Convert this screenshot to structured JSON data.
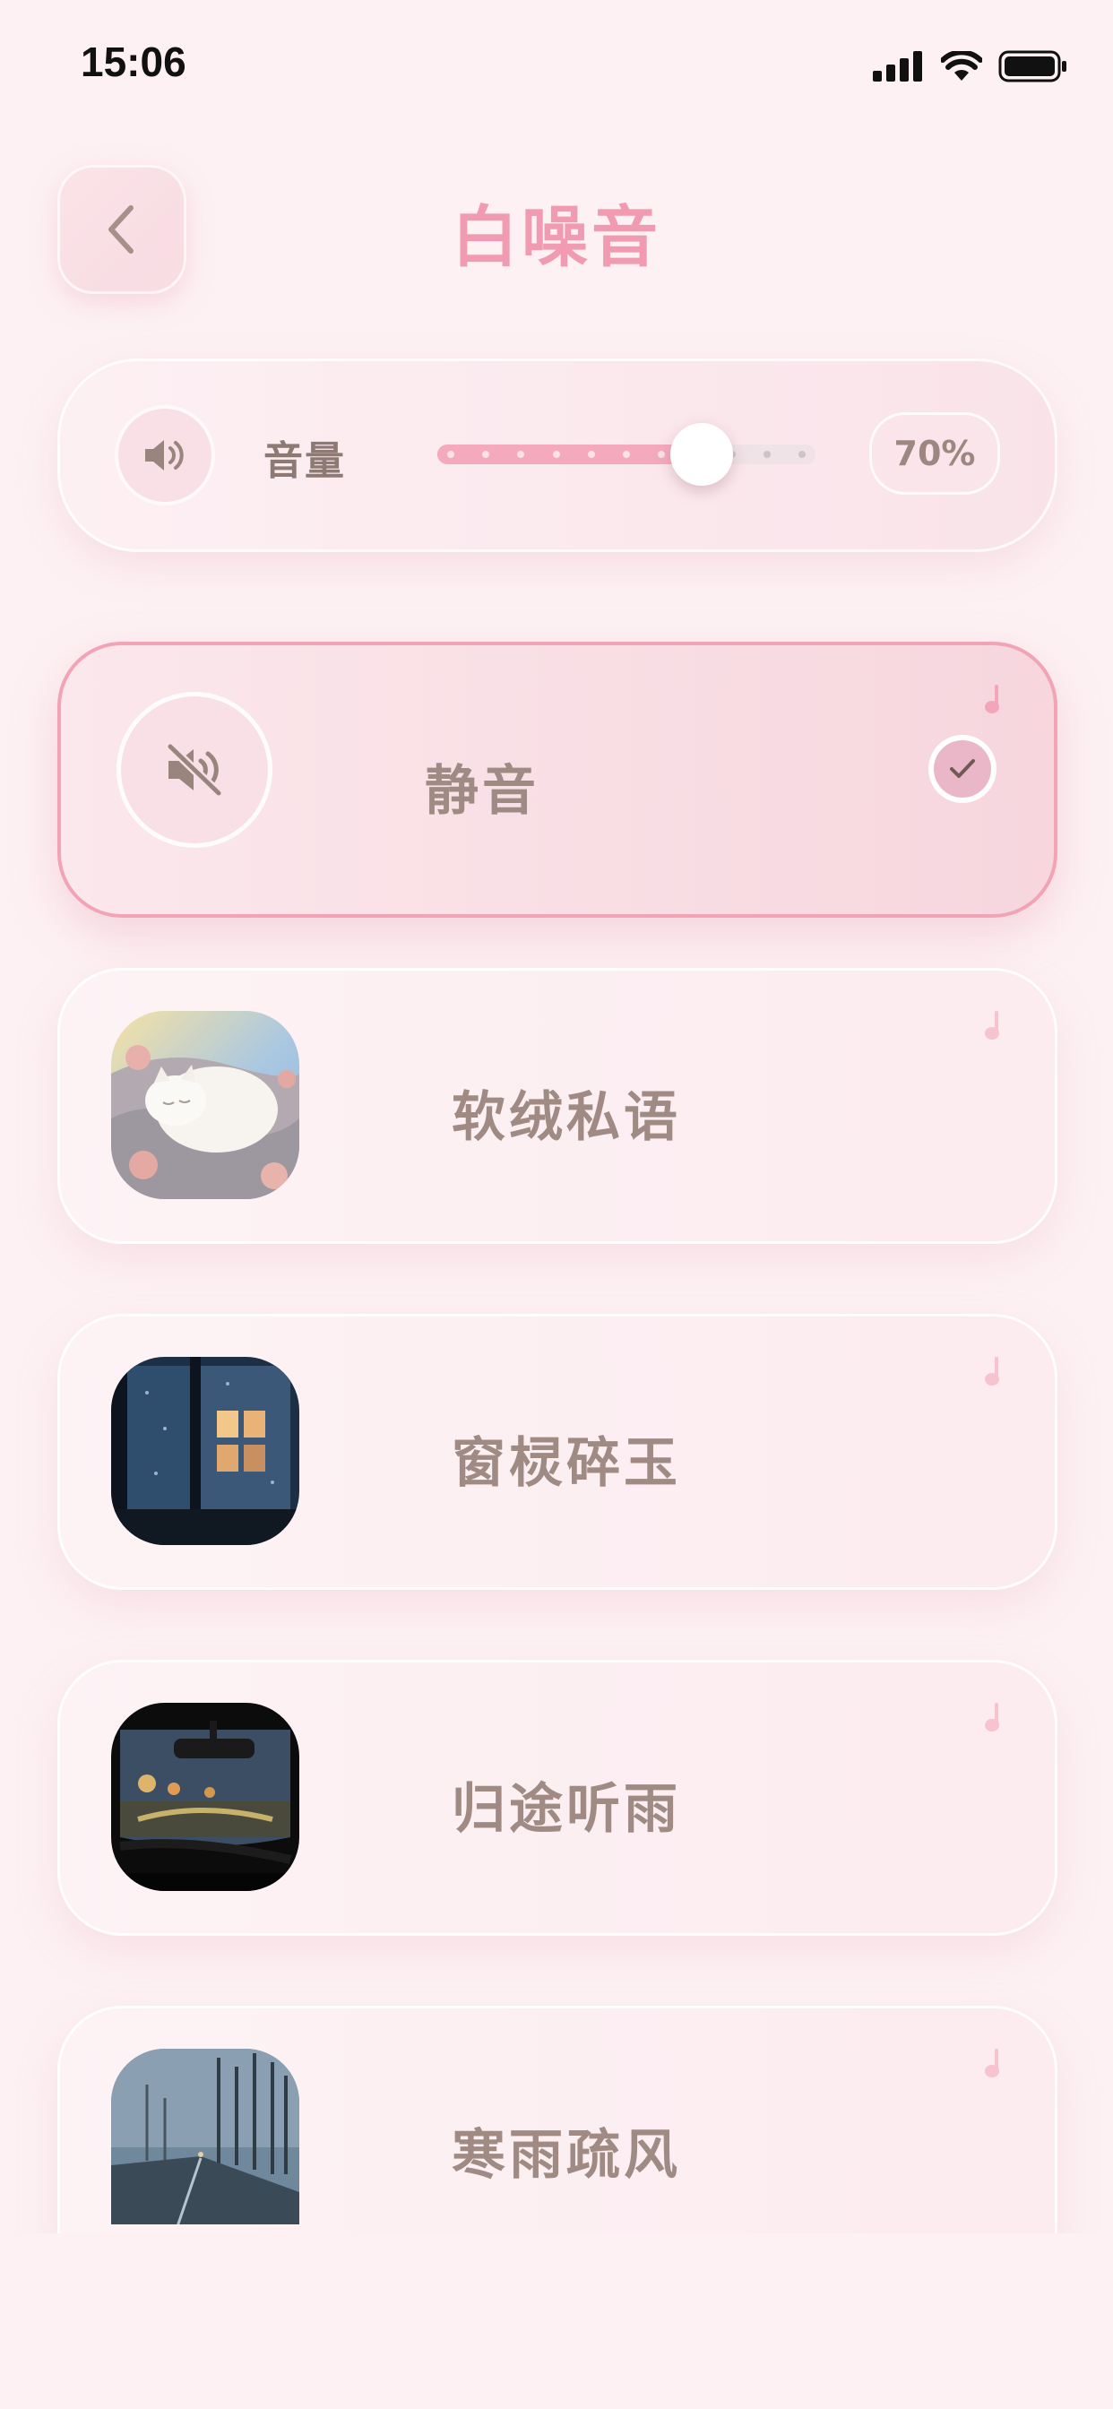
{
  "status_bar": {
    "time": "15:06"
  },
  "header": {
    "title": "白噪音"
  },
  "volume": {
    "label": "音量",
    "value_text": "70%",
    "level": 0.7
  },
  "sounds": [
    {
      "label": "静音",
      "selected": true
    },
    {
      "label": "软绒私语",
      "selected": false
    },
    {
      "label": "窗棂碎玉",
      "selected": false
    },
    {
      "label": "归途听雨",
      "selected": false
    },
    {
      "label": "寒雨疏风",
      "selected": false
    }
  ],
  "colors": {
    "accent": "#f09bb1",
    "text": "#a08b84",
    "selected_border": "#f2a4b6",
    "background": "#fdf1f3"
  }
}
